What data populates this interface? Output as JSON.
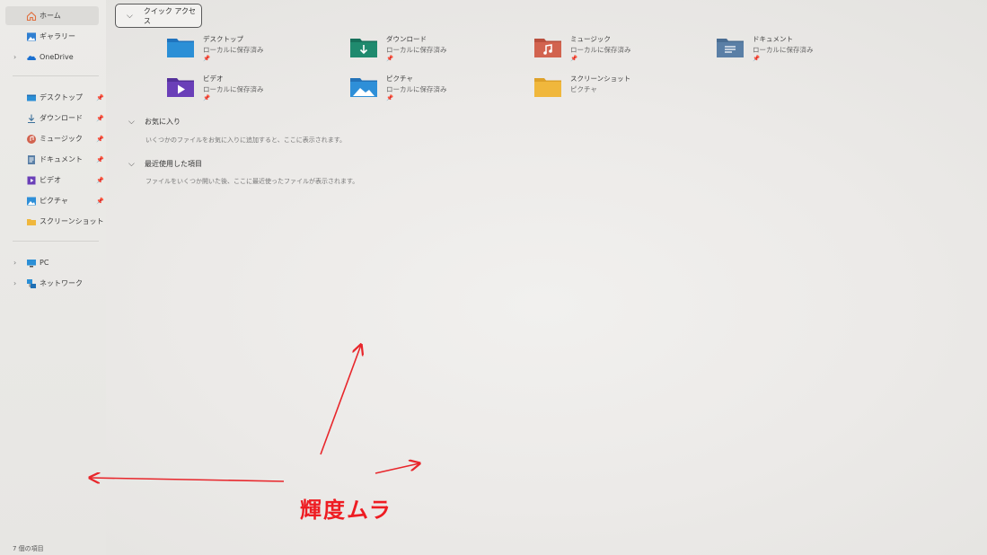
{
  "sidebar": {
    "items": [
      {
        "label": "ホーム",
        "icon": "home-icon"
      },
      {
        "label": "ギャラリー",
        "icon": "gallery-icon"
      },
      {
        "label": "OneDrive",
        "icon": "cloud-icon"
      }
    ],
    "pinned": [
      {
        "label": "デスクトップ",
        "icon": "desktop-icon"
      },
      {
        "label": "ダウンロード",
        "icon": "download-icon"
      },
      {
        "label": "ミュージック",
        "icon": "music-icon"
      },
      {
        "label": "ドキュメント",
        "icon": "document-icon"
      },
      {
        "label": "ビデオ",
        "icon": "video-icon"
      },
      {
        "label": "ピクチャ",
        "icon": "pictures-icon"
      },
      {
        "label": "スクリーンショット",
        "icon": "folder-icon"
      }
    ],
    "devices": [
      {
        "label": "PC",
        "icon": "pc-icon"
      },
      {
        "label": "ネットワーク",
        "icon": "network-icon"
      }
    ]
  },
  "status_bar": {
    "item_count": "7 個の項目"
  },
  "quick_access": {
    "header": "クイック アクセス",
    "tiles": [
      {
        "name": "デスクトップ",
        "sub": "ローカルに保存済み",
        "pinned": true,
        "icon": "desktop-folder-icon",
        "color": "#2b8fd6"
      },
      {
        "name": "ダウンロード",
        "sub": "ローカルに保存済み",
        "pinned": true,
        "icon": "download-folder-icon",
        "color": "#1f8a6e"
      },
      {
        "name": "ミュージック",
        "sub": "ローカルに保存済み",
        "pinned": true,
        "icon": "music-folder-icon",
        "color": "#d2634f"
      },
      {
        "name": "ドキュメント",
        "sub": "ローカルに保存済み",
        "pinned": true,
        "icon": "document-folder-icon",
        "color": "#5a7fa6"
      },
      {
        "name": "ビデオ",
        "sub": "ローカルに保存済み",
        "pinned": true,
        "icon": "video-folder-icon",
        "color": "#6a3fb8"
      },
      {
        "name": "ピクチャ",
        "sub": "ローカルに保存済み",
        "pinned": true,
        "icon": "pictures-folder-icon",
        "color": "#2e8fd8"
      },
      {
        "name": "スクリーンショット",
        "sub": "ピクチャ",
        "pinned": false,
        "icon": "screenshot-folder-icon",
        "color": "#f0b73c"
      }
    ]
  },
  "favorites": {
    "title": "お気に入り",
    "description": "いくつかのファイルをお気に入りに追加すると、ここに表示されます。"
  },
  "recent": {
    "title": "最近使用した項目",
    "description": "ファイルをいくつか開いた後、ここに最近使ったファイルが表示されます。"
  },
  "annotation": {
    "text": "輝度ムラ",
    "color": "#ee1c22"
  }
}
